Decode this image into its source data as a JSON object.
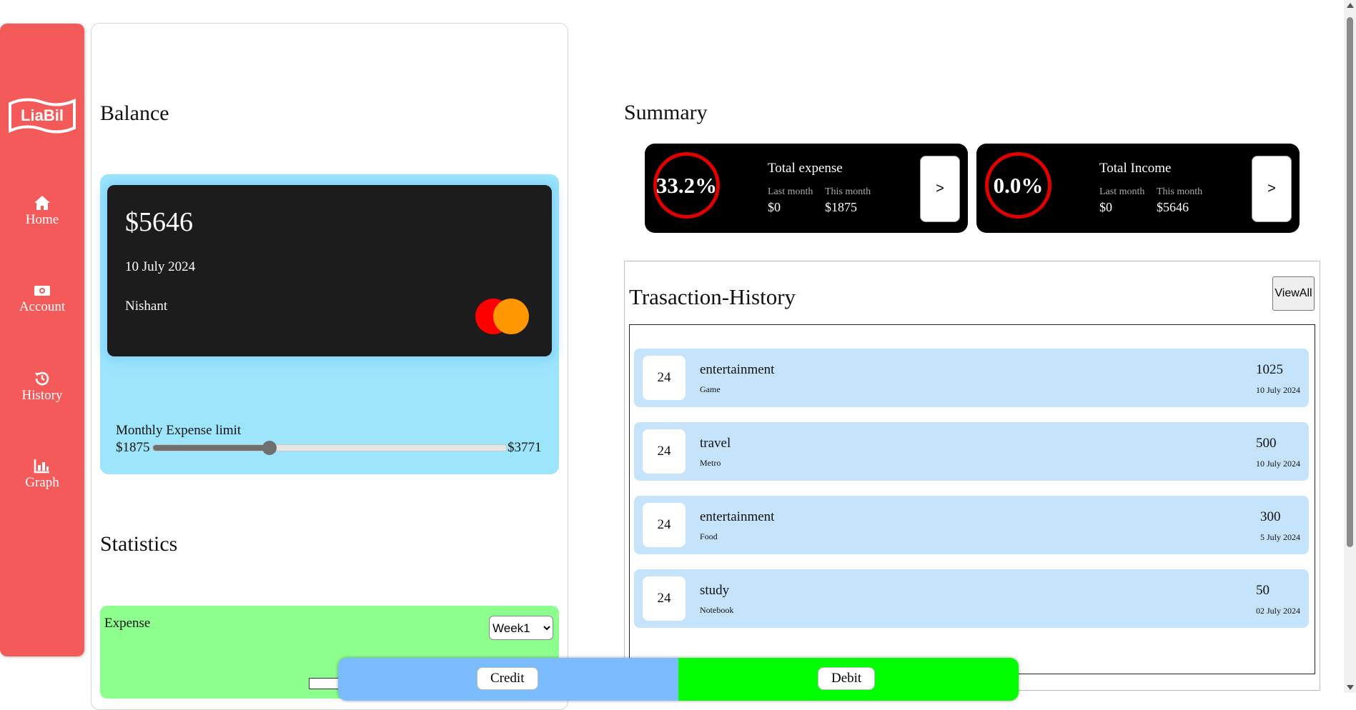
{
  "sidebar": {
    "logo_text": "LiaBil",
    "items": [
      {
        "label": "Home",
        "icon": "home-icon"
      },
      {
        "label": "Account",
        "icon": "money-icon"
      },
      {
        "label": "History",
        "icon": "history-icon"
      },
      {
        "label": "Graph",
        "icon": "chart-icon"
      }
    ]
  },
  "balance": {
    "heading": "Balance",
    "card": {
      "amount": "$5646",
      "date": "10 July 2024",
      "holder": "Nishant"
    },
    "limit": {
      "label": "Monthly Expense limit",
      "min_label": "$1875",
      "max_label": "$3771",
      "value_fraction": 0.33
    }
  },
  "statistics": {
    "heading": "Statistics",
    "label": "Expense",
    "selected_week": "Week1"
  },
  "summary": {
    "heading": "Summary",
    "cards": [
      {
        "percent": "33.2%",
        "title": "Total expense",
        "last_month_label": "Last month",
        "this_month_label": "This month",
        "last_month_value": "$0",
        "this_month_value": "$1875",
        "button": ">"
      },
      {
        "percent": "0.0%",
        "title": "Total Income",
        "last_month_label": "Last month",
        "this_month_label": "This month",
        "last_month_value": "$0",
        "this_month_value": "$5646",
        "button": ">"
      }
    ]
  },
  "history": {
    "heading": "Trasaction-History",
    "view_all": "ViewAll",
    "transactions": [
      {
        "day": "24",
        "category": "entertainment",
        "note": "Game",
        "amount": "1025",
        "date": "10 July 2024"
      },
      {
        "day": "24",
        "category": "travel",
        "note": "Metro",
        "amount": "500",
        "date": "10 July 2024"
      },
      {
        "day": "24",
        "category": "entertainment",
        "note": "Food",
        "amount": "300",
        "date": "5 July 2024"
      },
      {
        "day": "24",
        "category": "study",
        "note": "Notebook",
        "amount": "50",
        "date": "02 July 2024"
      }
    ]
  },
  "bottom_bar": {
    "credit": "Credit",
    "debit": "Debit"
  },
  "colors": {
    "sidebar": "#f55a5a",
    "balance_box": "#9de5fb",
    "card": "#1c1c1c",
    "stats_box": "#8cff8c",
    "summary_card": "#000000",
    "ring": "#e00000",
    "tx_row": "#c5e3fb",
    "credit": "#7bbcff",
    "debit": "#00ff00"
  }
}
